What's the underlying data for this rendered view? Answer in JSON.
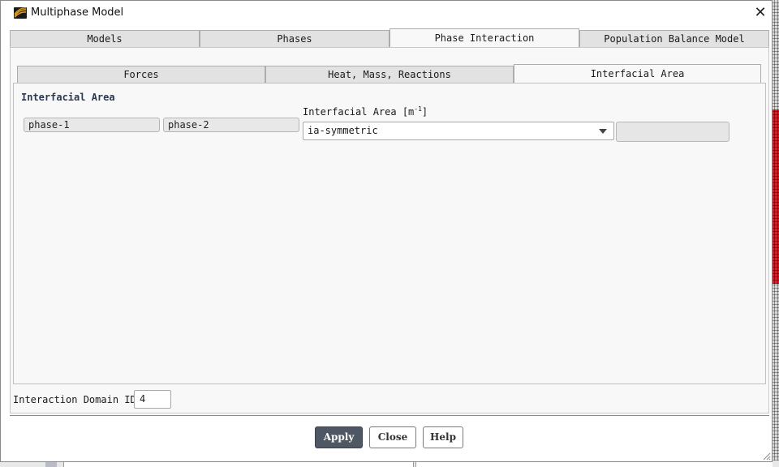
{
  "window": {
    "title": "Multiphase Model"
  },
  "main_tabs": [
    {
      "label": "Models",
      "active": false
    },
    {
      "label": "Phases",
      "active": false
    },
    {
      "label": "Phase Interaction",
      "active": true
    },
    {
      "label": "Population Balance Model",
      "active": false
    }
  ],
  "sub_tabs": [
    {
      "label": "Forces",
      "active": false
    },
    {
      "label": "Heat, Mass, Reactions",
      "active": false
    },
    {
      "label": "Interfacial Area",
      "active": true
    }
  ],
  "interfacial_area": {
    "section_title": "Interfacial Area",
    "phase_1": "phase-1",
    "phase_2": "phase-2",
    "column_label": "Interfacial Area [m",
    "column_label_exp": "-1",
    "column_label_end": "]",
    "selected_method": "ia-symmetric",
    "extra_value": ""
  },
  "domain": {
    "label": "Interaction Domain ID",
    "value": "4"
  },
  "buttons": {
    "apply": "Apply",
    "close": "Close",
    "help": "Help"
  },
  "colors": {
    "primary_button": "#4e5764",
    "section_title": "#2b3a52",
    "mesh_red": "#d8202a"
  },
  "icons": {
    "app": "fluent-app-icon",
    "close": "close-icon",
    "dropdown": "chevron-down-icon",
    "resize": "resize-grip-icon"
  }
}
